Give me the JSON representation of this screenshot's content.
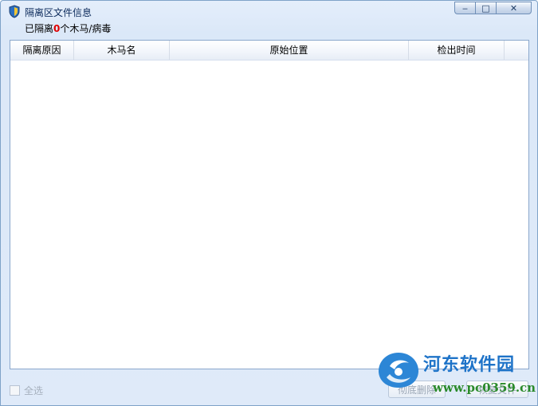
{
  "window": {
    "title": "隔离区文件信息",
    "controls": {
      "minimize": "‒",
      "maximize": "□",
      "close": "✕"
    }
  },
  "summary": {
    "prefix": "已隔离",
    "count": "0",
    "suffix": "个木马/病毒"
  },
  "table": {
    "columns": [
      "隔离原因",
      "木马名",
      "原始位置",
      "检出时间"
    ],
    "rows": []
  },
  "footer": {
    "select_all_label": "全选",
    "delete_button": "彻底删除",
    "restore_button": "恢复文件"
  },
  "watermark": {
    "title": "河东软件园",
    "url": "www.pc0359.cn"
  },
  "colors": {
    "count_highlight": "#e00000",
    "title_text": "#0b2a5b",
    "watermark_blue": "#1e73c8",
    "watermark_green": "#2a8a2a"
  },
  "icons": {
    "app": "shield-icon",
    "watermark": "logo-icon"
  }
}
